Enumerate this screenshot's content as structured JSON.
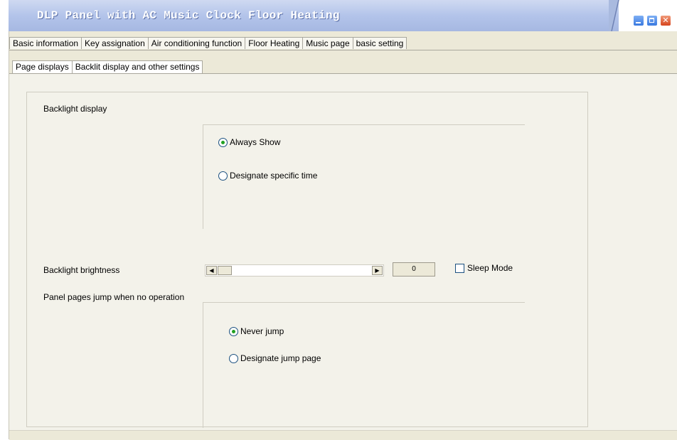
{
  "window": {
    "title": "DLP Panel with AC Music Clock Floor Heating",
    "controls": {
      "minimize_icon": "minimize-icon",
      "maximize_icon": "maximize-icon",
      "close_icon": "close-icon"
    }
  },
  "tabs": [
    {
      "label": "Basic information"
    },
    {
      "label": "Key assignation"
    },
    {
      "label": "Air conditioning function"
    },
    {
      "label": "Floor Heating"
    },
    {
      "label": "Music page"
    },
    {
      "label": "basic setting"
    }
  ],
  "subtabs": [
    {
      "label": "Page displays"
    },
    {
      "label": "Backlit display and other settings"
    }
  ],
  "backlight_display": {
    "label": "Backlight display",
    "options": [
      {
        "label": "Always Show",
        "selected": true
      },
      {
        "label": "Designate specific time",
        "selected": false
      }
    ]
  },
  "backlight_brightness": {
    "label": "Backlight brightness",
    "value": "0",
    "sleep_mode_label": "Sleep Mode",
    "sleep_mode_checked": false
  },
  "panel_jump": {
    "label": "Panel pages jump when no operation",
    "options": [
      {
        "label": "Never jump",
        "selected": true
      },
      {
        "label": "Designate jump page",
        "selected": false
      }
    ]
  }
}
